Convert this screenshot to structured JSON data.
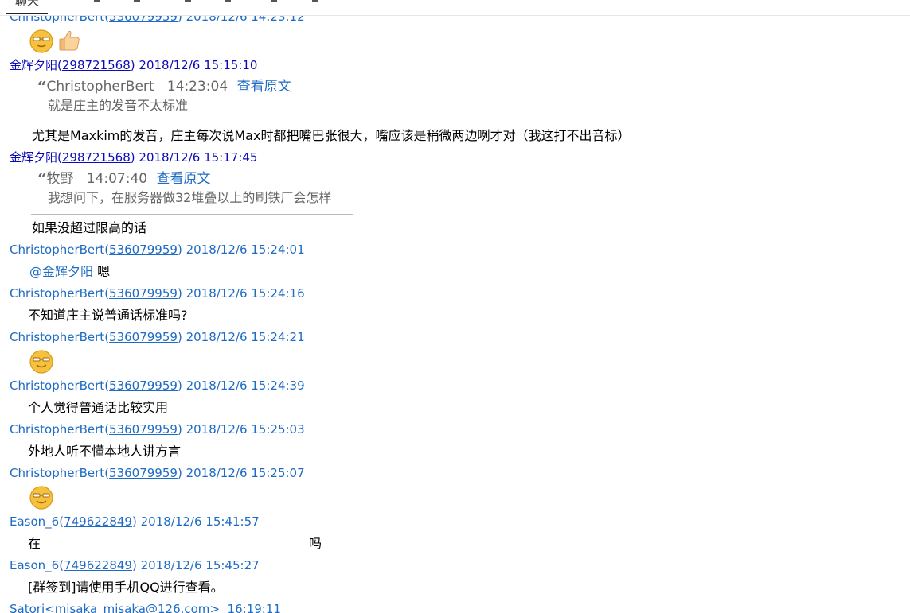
{
  "tabs": {
    "first_label": "聊天"
  },
  "messages": [
    {
      "sender": "ChristopherBert",
      "qq": "536079959",
      "time": "2018/12/6 14:23:12",
      "emoji": [
        "smile-glasses-icon",
        "thumbs-up-icon"
      ]
    },
    {
      "sender": "金辉夕阳",
      "qq": "298721568",
      "time": "2018/12/6 15:15:10",
      "quote": {
        "author": "ChristopherBert",
        "time": "14:23:04",
        "view_label": "查看原文",
        "text": "就是庄主的发音不太标准"
      },
      "text": "尤其是Maxkim的发音，庄主每次说Max时都把嘴巴张很大，嘴应该是稍微两边咧才对（我这打不出音标）"
    },
    {
      "sender": "金辉夕阳",
      "qq": "298721568",
      "time": "2018/12/6 15:17:45",
      "quote": {
        "author": "牧野",
        "time": "14:07:40",
        "view_label": "查看原文",
        "text": "我想问下，在服务器做32堆叠以上的刷铁厂会怎样"
      },
      "text": "如果没超过限高的话"
    },
    {
      "sender": "ChristopherBert",
      "qq": "536079959",
      "time": "2018/12/6 15:24:01",
      "mention": "@金辉夕阳",
      "text": "嗯"
    },
    {
      "sender": "ChristopherBert",
      "qq": "536079959",
      "time": "2018/12/6 15:24:16",
      "text": "不知道庄主说普通话标准吗?"
    },
    {
      "sender": "ChristopherBert",
      "qq": "536079959",
      "time": "2018/12/6 15:24:21",
      "emoji": [
        "smile-glasses-icon"
      ]
    },
    {
      "sender": "ChristopherBert",
      "qq": "536079959",
      "time": "2018/12/6 15:24:39",
      "text": "个人觉得普通话比较实用"
    },
    {
      "sender": "ChristopherBert",
      "qq": "536079959",
      "time": "2018/12/6 15:25:03",
      "text": "外地人听不懂本地人讲方言"
    },
    {
      "sender": "ChristopherBert",
      "qq": "536079959",
      "time": "2018/12/6 15:25:07",
      "emoji": [
        "smile-glasses-icon"
      ]
    },
    {
      "sender": "Eason_6",
      "qq": "749622849",
      "time": "2018/12/6 15:41:57",
      "text_start": "在",
      "text_end": "吗"
    },
    {
      "sender": "Eason_6",
      "qq": "749622849",
      "time": "2018/12/6 15:45:27",
      "text": "[群签到]请使用手机QQ进行查看。"
    },
    {
      "sender": "Satori",
      "email": "misaka_misaka@126.com",
      "time": "16:19:11"
    }
  ],
  "colors": {
    "sender_blue": "#1e6bc4",
    "sender_dark_blue": "#0b0bb8",
    "quote_gray": "#666666"
  }
}
